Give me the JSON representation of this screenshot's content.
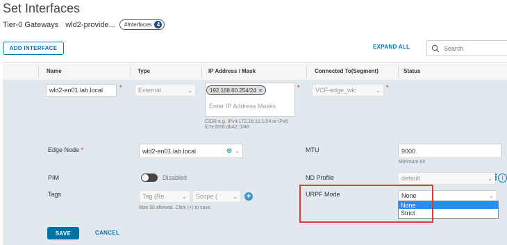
{
  "page": {
    "title": "Set Interfaces"
  },
  "breadcrumb": {
    "gateway_label": "Tier-0 Gateways",
    "gateway_name": "wld2-provide...",
    "interfaces_tag": "#Interfaces",
    "interfaces_count": "4"
  },
  "toolbar": {
    "add_interface_label": "ADD INTERFACE",
    "expand_all_label": "EXPAND ALL",
    "search_placeholder": "Search"
  },
  "table": {
    "columns": [
      "Name",
      "Type",
      "IP Address / Mask",
      "Connected To(Segment)",
      "Status"
    ]
  },
  "row": {
    "name_value": "wld2-en01.lab.local",
    "type_value": "External",
    "ip_chip": "192.168.60.254/24",
    "ip_placeholder": "Enter IP Address Masks",
    "cidr_hint": "CIDR e.g. IPv4:172.16.10.1/24 or IPv6 fc7e:f206:db42::1/48",
    "segment_value": "VCF-edge_wlc"
  },
  "details": {
    "edge_node_label": "Edge Node",
    "edge_node_value": "wld2-en01.lab.local",
    "mtu_label": "MTU",
    "mtu_value": "9000",
    "mtu_hint": "Minimum 64",
    "pim_label": "PIM",
    "pim_state": "Disabled",
    "nd_profile_label": "ND Profile",
    "nd_profile_value": "default",
    "tags_label": "Tags",
    "tag_placeholder": "Tag (Re",
    "scope_placeholder": "Scope (",
    "tags_hint": "Max 30 allowed. Click (+) to save.",
    "urpf_label": "URPF Mode",
    "urpf_value": "None",
    "urpf_options": [
      "None",
      "Strict"
    ]
  },
  "actions": {
    "save_label": "SAVE",
    "cancel_label": "CANCEL"
  },
  "colors": {
    "accent": "#0079b8",
    "panel": "#e1e8ee",
    "highlight": "#d93b3b",
    "selected": "#1e90ff"
  }
}
